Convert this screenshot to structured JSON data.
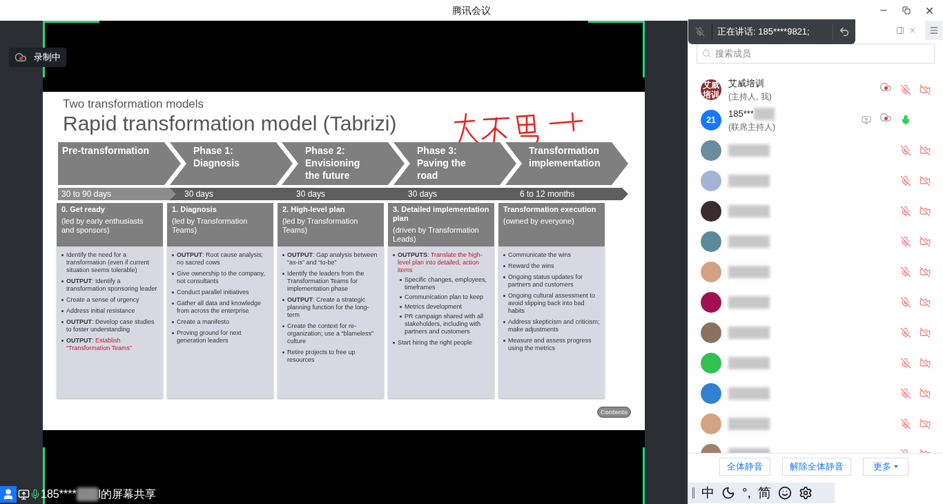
{
  "window": {
    "title": "腾讯会议"
  },
  "recording_badge": {
    "label": "录制中"
  },
  "speaking_banner": {
    "text": "正在讲话: 185****9821;"
  },
  "slide": {
    "subtitle": "Two transformation models",
    "title": "Rapid transformation model (Tabrizi)",
    "phases": [
      {
        "heading": "Pre-transformation",
        "duration": "30 to 90 days",
        "box_title": "0. Get ready",
        "box_subtitle": "(led by early enthusiasts and sponsors)",
        "bullets": [
          {
            "text": "Identify the need for a transformation (even if current situation seems tolerable)"
          },
          {
            "text": "**OUTPUT**: Identify a transformation sponsoring leader"
          },
          {
            "text": "Create a sense of urgency"
          },
          {
            "text": "Address initial resistance"
          },
          {
            "text": "**OUTPUT**: Develop case studies to foster understanding"
          },
          {
            "text": "**OUTPUT**: ",
            "highlight": "Establish “Transformation Teams”"
          }
        ]
      },
      {
        "heading": "Phase 1: Diagnosis",
        "duration": "30 days",
        "box_title": "1. Diagnosis",
        "box_subtitle": "(led by Transformation Teams)",
        "bullets": [
          {
            "text": "**OUTPUT**: Root cause analysis; no sacred cows"
          },
          {
            "text": "Give ownership to the company, not consultants"
          },
          {
            "text": "Conduct parallel initiatives"
          },
          {
            "text": "Gather all data  and knowledge from across the enterprise"
          },
          {
            "text": "Create a manifesto"
          },
          {
            "text": "Proving ground for next generation leaders"
          }
        ]
      },
      {
        "heading": "Phase 2: Envisioning the future",
        "duration": "30 days",
        "box_title": "2. High-level plan",
        "box_subtitle": "(led by Transformation Teams)",
        "bullets": [
          {
            "text": "**OUTPUT**: Gap analysis between “as-is” and “to-be”"
          },
          {
            "text": "Identify the leaders from the Transformation Teams for implementation phase"
          },
          {
            "text": "**OUTPUT**: Create a strategic planning function for the long-term"
          },
          {
            "text": "Create the context for re-organization; use a “blameless” culture"
          },
          {
            "text": "Retire projects to free up resources"
          }
        ]
      },
      {
        "heading": "Phase 3: Paving the road",
        "duration": "30 days",
        "box_title": "3. Detailed implementation plan",
        "box_subtitle": "(driven by Transformation Leads)",
        "bullets": [
          {
            "text": "**OUTPUTS**: ",
            "highlight": "Translate the high-level plan into detailed, action items",
            "children": [
              {
                "text": "Specific changes, employees, timeframes"
              },
              {
                "text": "Communication plan to keep"
              },
              {
                "text": "Metrics development"
              },
              {
                "text": "PR campaign shared with all stakeholders, including with partners and customers"
              }
            ]
          },
          {
            "text": "Start hiring the right people"
          }
        ]
      },
      {
        "heading": "Transformation implementation",
        "duration": "6 to 12 months",
        "box_title": "Transformation execution",
        "box_subtitle": "(owned by everyone)",
        "bullets": [
          {
            "text": "Communicate the wins"
          },
          {
            "text": "Reward the wins"
          },
          {
            "text": "Ongoing status updates for partners and customers"
          },
          {
            "text": "Ongoing cultural assessment to avoid slipping back into bad habits"
          },
          {
            "text": "Address skepticism and criticism; make adjustments"
          },
          {
            "text": "Measure and assess progress using the metrics"
          }
        ]
      }
    ],
    "contents_button": "Contents"
  },
  "share_status": {
    "name_start": "185****",
    "name_end": "l的屏幕共享"
  },
  "members": {
    "search": {
      "placeholder": "搜索成员"
    },
    "participants": [
      {
        "avatar_text": "艾威培训",
        "color": "#8b2c2c",
        "name": "艾威培训",
        "role": "(主持人, 我)",
        "blurred": false,
        "sharing": false,
        "recording": true,
        "mic_on": false,
        "camera": true
      },
      {
        "avatar_text": "21",
        "color": "#1677ff",
        "name": "185***",
        "role": "(联席主持人)",
        "blurred": true,
        "sharing": true,
        "recording": true,
        "mic_on": true,
        "camera": false
      },
      {
        "color": "#6b8c9c",
        "blurred": true,
        "sharing": false,
        "recording": false,
        "mic_on": false,
        "camera": true
      },
      {
        "color": "#a3b4d4",
        "blurred": true,
        "sharing": false,
        "recording": false,
        "mic_on": false,
        "camera": true
      },
      {
        "color": "#3b2b2b",
        "blurred": true,
        "sharing": false,
        "recording": false,
        "mic_on": false,
        "camera": true
      },
      {
        "color": "#5b8b9b",
        "blurred": true,
        "sharing": false,
        "recording": false,
        "mic_on": false,
        "camera": true
      },
      {
        "color": "#d2a282",
        "blurred": true,
        "sharing": false,
        "recording": false,
        "mic_on": false,
        "camera": true
      },
      {
        "color": "#a11151",
        "blurred": true,
        "sharing": false,
        "recording": false,
        "mic_on": false,
        "camera": true
      },
      {
        "color": "#8b7161",
        "blurred": true,
        "sharing": false,
        "recording": false,
        "mic_on": false,
        "camera": true
      },
      {
        "color": "#31c151",
        "blurred": true,
        "sharing": false,
        "recording": false,
        "mic_on": false,
        "camera": true
      },
      {
        "color": "#3181d1",
        "blurred": true,
        "sharing": false,
        "recording": false,
        "mic_on": false,
        "camera": true
      },
      {
        "color": "#d3a383",
        "blurred": true,
        "sharing": false,
        "recording": false,
        "mic_on": false,
        "camera": true
      },
      {
        "color": "#a18171",
        "blurred": true,
        "sharing": false,
        "recording": false,
        "mic_on": false,
        "camera": true
      }
    ],
    "buttons": [
      "全体静音",
      "解除全体静音",
      "更多"
    ]
  },
  "ime_toolbar": {
    "items": [
      {
        "kind": "text",
        "label": "中"
      },
      {
        "kind": "moon"
      },
      {
        "kind": "text",
        "label": "°,"
      },
      {
        "kind": "text",
        "label": "简"
      },
      {
        "kind": "smile"
      },
      {
        "kind": "gear"
      }
    ]
  }
}
